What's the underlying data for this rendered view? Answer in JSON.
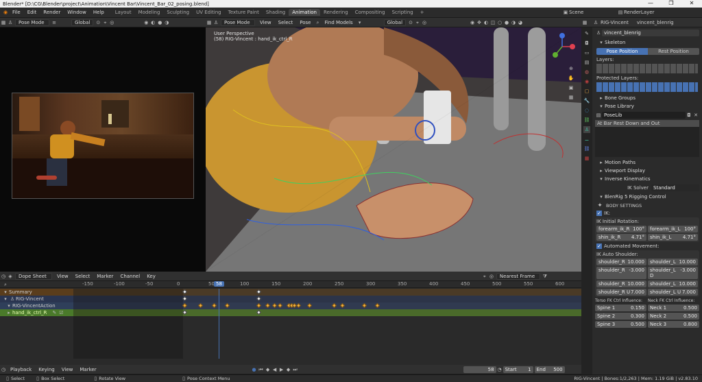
{
  "window": {
    "title": "Blender* [D:\\CG\\Blender\\project\\Animation\\Vincent Bar\\Vincent_Bar_02_posing.blend]",
    "controls": [
      "—",
      "❐",
      "✕"
    ]
  },
  "menu": [
    "File",
    "Edit",
    "Render",
    "Window",
    "Help"
  ],
  "workspaces": {
    "tabs": [
      "Layout",
      "Modeling",
      "Sculpting",
      "UV Editing",
      "Texture Paint",
      "Shading",
      "Animation",
      "Rendering",
      "Compositing",
      "Scripting"
    ],
    "active": "Animation",
    "add": "+"
  },
  "scene": {
    "label": "Scene",
    "render_layer": "RenderLayer"
  },
  "viewport_left": {
    "mode": "Pose Mode"
  },
  "viewport_main": {
    "mode": "Pose Mode",
    "menus": [
      "View",
      "Select",
      "Pose"
    ],
    "find_models": "Find Models",
    "orientation": "Global",
    "overlay_line1": "User Perspective",
    "overlay_line2": "(58) RIG-Vincent : hand_ik_ctrl_R"
  },
  "viewport_left_header": {
    "orientation": "Global"
  },
  "properties": {
    "header_obj": "RIG-Vincent",
    "header_armature": "vincent_blenrig",
    "name_field": "vincent_blenrig",
    "skeleton_label": "Skeleton",
    "pose_position": "Pose Position",
    "rest_position": "Rest Position",
    "layers_label": "Layers:",
    "protected_layers_label": "Protected Layers:",
    "bone_groups": "Bone Groups",
    "pose_library": "Pose Library",
    "poselib_name": "PoseLib",
    "poselib_entry": "At Bar Rest Down and Out",
    "motion_paths": "Motion Paths",
    "viewport_display": "Viewport Display",
    "inverse_kinematics": "Inverse Kinematics",
    "ik_solver_label": "IK Solver",
    "ik_solver_value": "Standard",
    "blenrig_panel": "BlenRig 5 Rigging Control",
    "body_settings": "BODY SETTINGS",
    "ik_checkbox": "IK:",
    "ik_initial_rotation": "IK Initial Rotation:",
    "ik_rot": [
      {
        "name": "forearm_ik_R",
        "value": "100°"
      },
      {
        "name": "forearm_ik_L",
        "value": "100°"
      },
      {
        "name": "shin_ik_R",
        "value": "4.71°"
      },
      {
        "name": "shin_ik_L",
        "value": "4.71°"
      }
    ],
    "automated_movement": "Automated Movement:",
    "ik_auto_shoulder": "IK Auto Shoulder:",
    "shoulder_fields": [
      {
        "name": "shoulder_R",
        "value": "10.000"
      },
      {
        "name": "shoulder_L",
        "value": "10.000"
      },
      {
        "name": "shoulder_R",
        "value": "-3.000"
      },
      {
        "name": "shoulder_L D",
        "value": "-3.000"
      },
      {
        "name": "shoulder_R",
        "value": "10.000"
      },
      {
        "name": "shoulder_L",
        "value": "10.000"
      },
      {
        "name": "shoulder_R U",
        "value": "7.000"
      },
      {
        "name": "shoulder_L U",
        "value": "7.000"
      }
    ],
    "torso_fk": "Torso FK Ctrl Influence:",
    "neck_fk": "Neck FK Ctrl Influence:",
    "spine": [
      {
        "name": "Spine 1",
        "value": "0.150"
      },
      {
        "name": "Spine 2",
        "value": "0.300"
      },
      {
        "name": "Spine 3",
        "value": "0.500"
      }
    ],
    "neck": [
      {
        "name": "Neck 1",
        "value": "0.500"
      },
      {
        "name": "Neck 2",
        "value": "0.500"
      },
      {
        "name": "Neck 3",
        "value": "0.800"
      }
    ],
    "tabs_icons": [
      "tool-icon",
      "render-icon",
      "output-icon",
      "view-layer-icon",
      "scene-icon",
      "world-icon",
      "object-icon",
      "modifier-icon",
      "particles-icon",
      "physics-icon",
      "constraints-icon",
      "data-icon",
      "bone-icon",
      "bone-constraint-icon",
      "texture-icon"
    ]
  },
  "dopesheet": {
    "mode": "Dope Sheet",
    "menus": [
      "View",
      "Select",
      "Marker",
      "Channel",
      "Key"
    ],
    "snap": "Nearest Frame",
    "ruler": [
      "-150",
      "-100",
      "-50",
      "0",
      "50",
      "100",
      "150",
      "200",
      "250",
      "300",
      "350",
      "400",
      "450",
      "500",
      "550",
      "600"
    ],
    "current_frame": "58",
    "channels": [
      "Summary",
      "RIG-Vincent",
      "RIG-VincentAction",
      "hand_ik_ctrl_R"
    ]
  },
  "playback": {
    "menus": [
      "Playback",
      "Keying",
      "View",
      "Marker"
    ],
    "current": "58",
    "start_label": "Start",
    "start": "1",
    "end_label": "End",
    "end": "500"
  },
  "status": {
    "select": "Select",
    "box_select": "Box Select",
    "rotate_view": "Rotate View",
    "context_menu": "Pose Context Menu",
    "stats": "RIG-Vincent | Bones:1/2,263 | Mem: 1.19 GiB | v2.83.10"
  }
}
